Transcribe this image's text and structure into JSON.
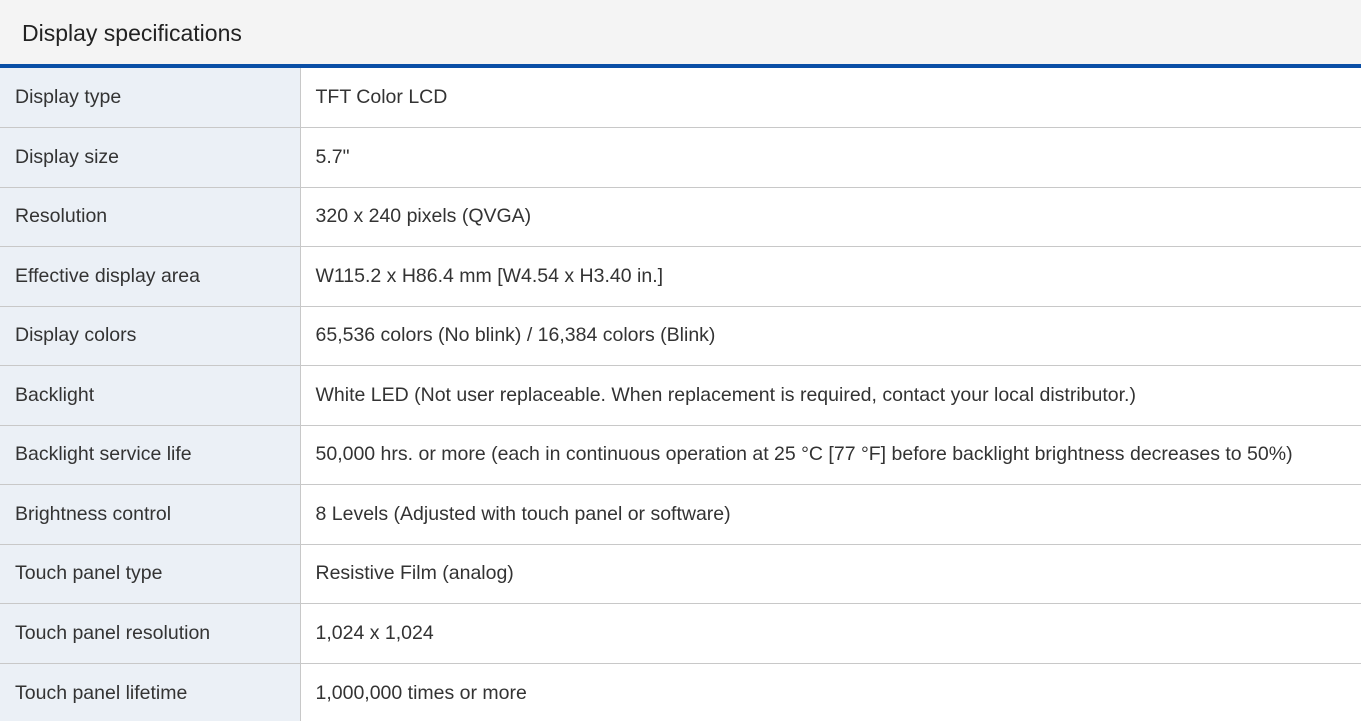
{
  "panel": {
    "title": "Display specifications"
  },
  "specs": [
    {
      "label": "Display type",
      "value": "TFT Color LCD"
    },
    {
      "label": "Display size",
      "value": "5.7\""
    },
    {
      "label": "Resolution",
      "value": "320 x 240 pixels (QVGA)"
    },
    {
      "label": "Effective display area",
      "value": "W115.2 x H86.4 mm [W4.54 x H3.40 in.]"
    },
    {
      "label": "Display colors",
      "value": "65,536 colors (No blink) / 16,384 colors (Blink)"
    },
    {
      "label": "Backlight",
      "value": "White LED (Not user replaceable. When replacement is required, contact your local distributor.)"
    },
    {
      "label": "Backlight service life",
      "value": "50,000 hrs. or more (each in continuous operation at 25 °C [77 °F] before backlight brightness decreases to 50%)"
    },
    {
      "label": "Brightness control",
      "value": "8 Levels (Adjusted with touch panel or software)"
    },
    {
      "label": "Touch panel type",
      "value": "Resistive Film (analog)"
    },
    {
      "label": "Touch panel resolution",
      "value": "1,024 x 1,024"
    },
    {
      "label": "Touch panel lifetime",
      "value": "1,000,000 times or more"
    }
  ],
  "colors": {
    "header_bg": "#f4f4f4",
    "header_rule": "#0a4fa6",
    "label_bg": "#ebf0f6",
    "border": "#c8c8c8",
    "text": "#333333"
  }
}
